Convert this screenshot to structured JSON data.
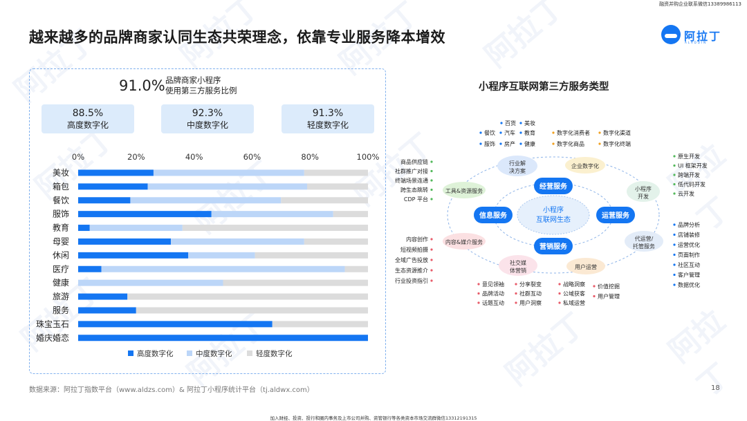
{
  "header": {
    "top_note": "融资并购企业联系微信13389986113",
    "title": "越来越多的品牌商家认同生态共荣理念，依靠专业服务降本增效",
    "logo_name": "阿拉丁",
    "logo_sub": "ALADDIN",
    "watermark": "阿拉丁"
  },
  "left": {
    "headline_value": "91.0%",
    "headline_label_line1": "品牌商家小程序",
    "headline_label_line2": "使用第三方服务比例",
    "stats": [
      {
        "value": "88.5%",
        "label": "高度数字化"
      },
      {
        "value": "92.3%",
        "label": "中度数字化"
      },
      {
        "value": "91.3%",
        "label": "轻度数字化"
      }
    ]
  },
  "chart_data": {
    "type": "bar",
    "orientation": "horizontal",
    "stacked": true,
    "categories": [
      "美妆",
      "箱包",
      "餐饮",
      "服饰",
      "教育",
      "母婴",
      "休闲",
      "医疗",
      "健康",
      "旅游",
      "服务",
      "珠宝玉石",
      "婚庆婚恋"
    ],
    "series": [
      {
        "name": "高度数字化",
        "color": "#1476f2",
        "values": [
          26,
          24,
          18,
          46,
          4,
          32,
          38,
          8,
          0,
          17,
          20,
          67,
          100
        ]
      },
      {
        "name": "中度数字化",
        "color": "#bcd6f8",
        "values": [
          52,
          55,
          52,
          42,
          32,
          46,
          23,
          84,
          50,
          0,
          0,
          0,
          0
        ]
      },
      {
        "name": "轻度数字化",
        "color": "#dcdcdc",
        "values": [
          22,
          21,
          30,
          12,
          64,
          22,
          39,
          8,
          50,
          83,
          80,
          33,
          0
        ]
      }
    ],
    "xlim": [
      0,
      100
    ],
    "xticks": [
      "0%",
      "20%",
      "40%",
      "60%",
      "80%",
      "100%"
    ],
    "legend_position": "bottom",
    "grid": false
  },
  "right": {
    "title": "小程序互联网第三方服务类型",
    "center_label1": "小程序",
    "center_label2": "互联网生态",
    "inner_nodes": [
      "经营服务",
      "信息服务",
      "运营服务",
      "营销服务"
    ],
    "outer_nodes": {
      "industry": [
        "行业解",
        "决方案"
      ],
      "enterprise": "企业数字化",
      "tools": "工具&资源服务",
      "miniprog": [
        "小程序",
        "开发"
      ],
      "content": "内容&媒介服务",
      "agency": [
        "代运营/",
        "托管服务"
      ],
      "social": [
        "社交媒",
        "体营销"
      ],
      "user_ops": "用户运营"
    },
    "top_tags": {
      "row1": [
        "百货",
        "美妆"
      ],
      "row2": [
        "餐饮",
        "汽车",
        "教育",
        "数字化消费者",
        "数字化渠道"
      ],
      "row3": [
        "服饰",
        "房产",
        "健康",
        "数字化商品",
        "数字化终端"
      ]
    },
    "left_tags_top": [
      "商品供应链",
      "社群推广对接",
      "终端场景连通",
      "跨生态跳转",
      "CDP 平台"
    ],
    "left_tags_bottom": [
      "内容创作",
      "短视频拍摄",
      "全域广告投放",
      "生态资源推介",
      "行业投资指引"
    ],
    "right_tags_top": [
      "原生开发",
      "UI 框架开发",
      "跨端开发",
      "低代码开发",
      "云开发"
    ],
    "right_tags_bottom": [
      "品牌分析",
      "店铺装修",
      "运营优化",
      "页面制作",
      "社区互动",
      "客户管理",
      "数据优化"
    ],
    "bottom_tags": {
      "col1": [
        "意见领袖",
        "品牌活动",
        "话题互动"
      ],
      "col2": [
        "分享裂变",
        "社群互动",
        "用户洞察"
      ],
      "col3": [
        "战略洞察",
        "公域获客",
        "私域运营"
      ],
      "col4": [
        "价值挖掘",
        "用户管理"
      ]
    }
  },
  "footer": {
    "source": "数据来源：阿拉丁指数平台（www.aldzs.com）& 阿拉丁小程序统计平台（tj.aldwx.com）",
    "page_number": "18",
    "bottom_note": "加入财经、投资、投行和圈内事务及上市公司并购、资管银行等各类资本市场交流群微信13312191315"
  }
}
